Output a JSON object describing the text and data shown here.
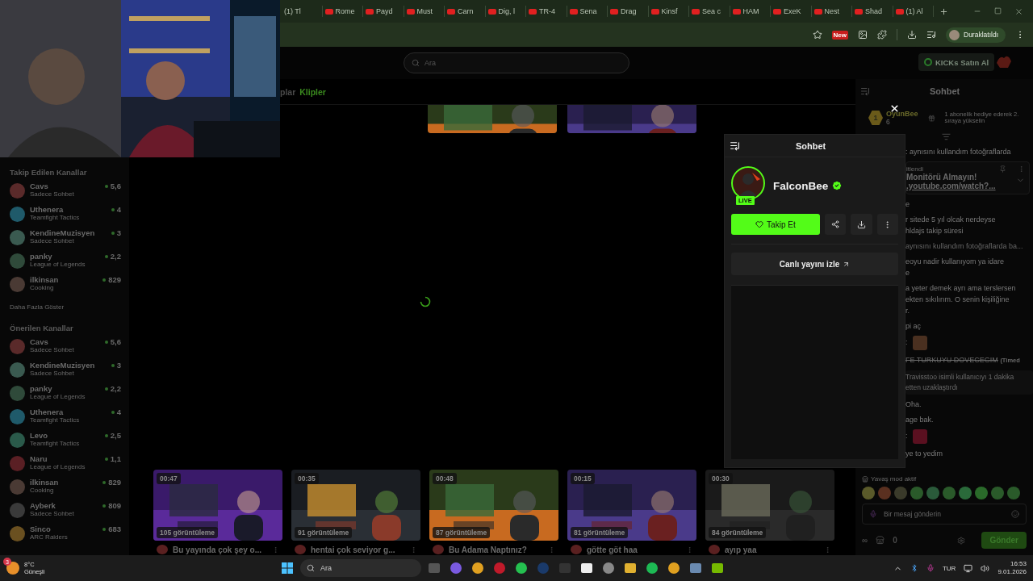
{
  "browser": {
    "tabs": [
      {
        "title": "(1) Tl",
        "kind": "cut"
      },
      {
        "title": "Rome",
        "kind": "video"
      },
      {
        "title": "Payd",
        "kind": "video"
      },
      {
        "title": "Must",
        "kind": "video"
      },
      {
        "title": "Carn",
        "kind": "video"
      },
      {
        "title": "Dig, l",
        "kind": "video"
      },
      {
        "title": "TR-4",
        "kind": "video"
      },
      {
        "title": "Sena",
        "kind": "video"
      },
      {
        "title": "Drag",
        "kind": "video"
      },
      {
        "title": "Kinsf",
        "kind": "video"
      },
      {
        "title": "Sea c",
        "kind": "video"
      },
      {
        "title": "HAM",
        "kind": "video"
      },
      {
        "title": "ExeK",
        "kind": "video"
      },
      {
        "title": "Nest",
        "kind": "video"
      },
      {
        "title": "Shad",
        "kind": "video"
      },
      {
        "title": "(1) Al",
        "kind": "video"
      }
    ],
    "new_badge": "New",
    "profile_label": "Duraklatıldı"
  },
  "topbar": {
    "search_placeholder": "Ara",
    "kicks_button": "KICKs Satın Al"
  },
  "channel_tabs": [
    {
      "label": "plar",
      "selected": false
    },
    {
      "label": "Klipler",
      "selected": true
    }
  ],
  "sidebar": {
    "sections": [
      {
        "title": "Takip Edilen Kanallar",
        "more": "Daha Fazla Göster",
        "channels": [
          {
            "name": "Cavs",
            "category": "Sadece Sohbet",
            "viewers": "5,6",
            "color": "#5a2a2a"
          },
          {
            "name": "Uthenera",
            "category": "Teamfight Tactics",
            "viewers": "4",
            "color": "#1f5a6a"
          },
          {
            "name": "KendineMuzisyen",
            "category": "Sadece Sohbet",
            "viewers": "3",
            "color": "#3a5a50"
          },
          {
            "name": "panky",
            "category": "League of Legends",
            "viewers": "2,2",
            "color": "#2f4a3a"
          },
          {
            "name": "ilkinsan",
            "category": "Cooking",
            "viewers": "829",
            "color": "#4a3a34"
          }
        ]
      },
      {
        "title": "Önerilen Kanallar",
        "channels": [
          {
            "name": "Cavs",
            "category": "Sadece Sohbet",
            "viewers": "5,6",
            "color": "#5a2a2a"
          },
          {
            "name": "KendineMuzisyen",
            "category": "Sadece Sohbet",
            "viewers": "3",
            "color": "#3a5a50"
          },
          {
            "name": "panky",
            "category": "League of Legends",
            "viewers": "2,2",
            "color": "#2f4a3a"
          },
          {
            "name": "Uthenera",
            "category": "Teamfight Tactics",
            "viewers": "4",
            "color": "#1f5a6a"
          },
          {
            "name": "Levo",
            "category": "Teamfight Tactics",
            "viewers": "2,5",
            "color": "#2a5a4a"
          },
          {
            "name": "Naru",
            "category": "League of Legends",
            "viewers": "1,1",
            "color": "#5a1f24"
          },
          {
            "name": "ilkinsan",
            "category": "Cooking",
            "viewers": "829",
            "color": "#4a3a34"
          },
          {
            "name": "Ayberk",
            "category": "Sadece Sohbet",
            "viewers": "809",
            "color": "#3a3a3a"
          },
          {
            "name": "Sinco",
            "category": "ARC Raiders",
            "viewers": "683",
            "color": "#6a5020"
          }
        ]
      }
    ]
  },
  "clips": [
    {
      "duration": "00:47",
      "views": "105 görüntüleme",
      "title": "Bu yayında çok şey o..."
    },
    {
      "duration": "00:35",
      "views": "91 görüntüleme",
      "title": "hentai çok seviyor g..."
    },
    {
      "duration": "00:48",
      "views": "87 görüntüleme",
      "title": "Bu Adama Naptınız?"
    },
    {
      "duration": "00:15",
      "views": "81 görüntüleme",
      "title": "götte göt haa"
    },
    {
      "duration": "00:30",
      "views": "84 görüntüleme",
      "title": "ayıp yaa"
    }
  ],
  "modal": {
    "title": "Sohbet",
    "streamer": "FalconBee",
    "verified": true,
    "live_badge": "LIVE",
    "follow_button": "Takip Et",
    "watch_button": "Canlı yayını izle"
  },
  "chat": {
    "title": "Sohbet",
    "top_gifter": {
      "rank": "1",
      "name": "OyunBee",
      "count": "6"
    },
    "gift_prompt": "1 abonelik hediye ederek 2. sıraya yükselin",
    "pinned": {
      "label": "itlendi",
      "title": "Monitörü Almayın!",
      "link": ".youtube.com/watch?..."
    },
    "messages": [
      {
        "kind": "text",
        "lines": [
          ": aynısını kullandım fotoğraflarda"
        ]
      },
      {
        "kind": "pinned_slot"
      },
      {
        "kind": "text",
        "lines": [
          "e"
        ]
      },
      {
        "kind": "text",
        "lines": [
          "r sitede 5 yıl olcak nerdeyse",
          "hldajs takip süresi"
        ]
      },
      {
        "kind": "reply",
        "lines": [
          "aynısını kullandım fotoğraflarda ba..."
        ]
      },
      {
        "kind": "text",
        "lines": [
          "eoyu nadir kullanıyom ya idare",
          "e"
        ]
      },
      {
        "kind": "text",
        "lines": [
          "a yeter demek ayrı ama terslersen",
          "ekten sıkılırım. O senin kişiliğine",
          "r."
        ]
      },
      {
        "kind": "text",
        "lines": [
          "pi aç"
        ]
      },
      {
        "kind": "emote",
        "lines": [
          ":"
        ]
      },
      {
        "kind": "deleted",
        "lines": [
          "FE TURKUYU DOVECEGIM"
        ],
        "note": "(Timed"
      },
      {
        "kind": "system",
        "lines": [
          "Travisstoo isimli kullanıcıyı 1 dakika",
          "etten uzaklaştırdı"
        ]
      },
      {
        "kind": "text",
        "lines": [
          "Oha."
        ]
      },
      {
        "kind": "text",
        "lines": [
          "age bak."
        ]
      },
      {
        "kind": "emote",
        "lines": [
          ":"
        ]
      },
      {
        "kind": "text",
        "lines": [
          "ye to yedim"
        ]
      }
    ],
    "slow_mode": "Yavaş mod aktif",
    "input_placeholder": "Bir mesaj gönderin",
    "points": "∞",
    "store_count": "0",
    "send_button": "Gönder"
  },
  "taskbar": {
    "weather_badge": "3",
    "temperature": "8°C",
    "condition": "Güneşli",
    "search_placeholder": "Ara",
    "language": "TUR",
    "time": "16:53",
    "date": "9.01.2026"
  }
}
